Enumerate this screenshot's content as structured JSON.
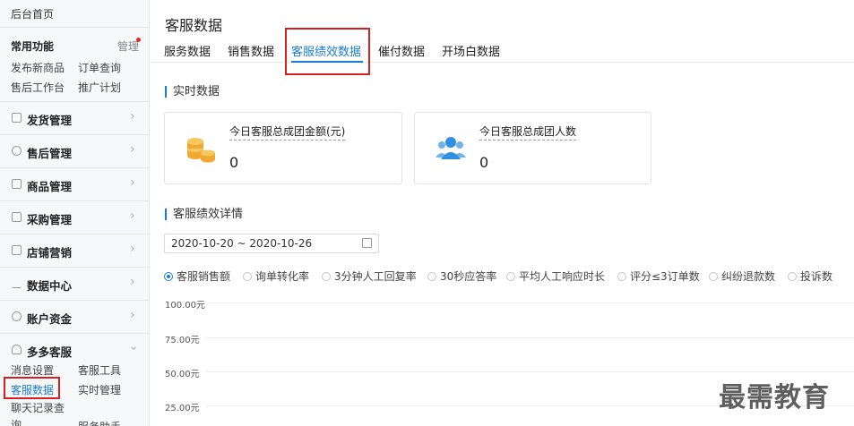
{
  "sidebar": {
    "home": "后台首页",
    "common_title": "常用功能",
    "manage": "管理",
    "common_links": [
      "发布新商品",
      "订单查询",
      "售后工作台",
      "推广计划"
    ],
    "sections": [
      "发货管理",
      "售后管理",
      "商品管理",
      "采购管理",
      "店铺营销",
      "数据中心",
      "账户资金"
    ],
    "open_section": "多多客服",
    "sub_links": [
      "消息设置",
      "客服工具",
      "客服数据",
      "实时管理",
      "聊天记录查询",
      "服务助手"
    ]
  },
  "main": {
    "title": "客服数据",
    "tabs": [
      "服务数据",
      "销售数据",
      "客服绩效数据",
      "催付数据",
      "开场白数据"
    ],
    "active_tab": "客服绩效数据",
    "realtime_title": "实时数据",
    "cards": [
      {
        "label": "今日客服总成团金额(元)",
        "value": "0",
        "icon": "coins-icon"
      },
      {
        "label": "今日客服总成团人数",
        "value": "0",
        "icon": "users-icon"
      }
    ],
    "detail_title": "客服绩效详情",
    "date_range": "2020-10-20 ~ 2020-10-26",
    "metrics": [
      "客服销售额",
      "询单转化率",
      "3分钟人工回复率",
      "30秒应答率",
      "平均人工响应时长",
      "评分≤3订单数",
      "纠纷退款数",
      "投诉数"
    ],
    "selected_metric": "客服销售额"
  },
  "chart_data": {
    "type": "line",
    "y_ticks": [
      "100.00元",
      "75.00元",
      "50.00元",
      "25.00元"
    ],
    "series": []
  },
  "watermark": "最需教育"
}
